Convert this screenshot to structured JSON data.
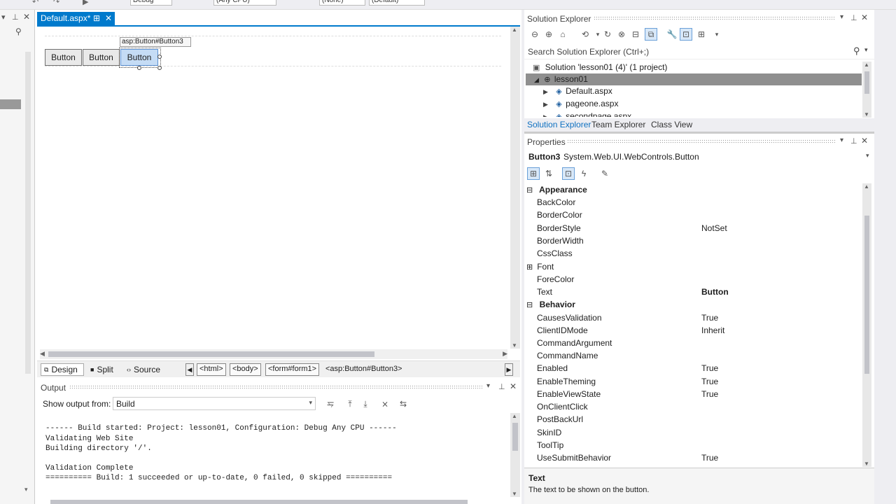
{
  "top_toolbar": {
    "config_value": "Debug",
    "cpu_value": "(Any CPU)",
    "none_value": "(None)",
    "default_value": "(Default)"
  },
  "doc_tab": {
    "label": "Default.aspx*",
    "pin": "⊞",
    "close": "✕"
  },
  "designer": {
    "tooltip": "asp:Button#Button3",
    "buttons": [
      "Button",
      "Button",
      "Button"
    ]
  },
  "view_bar": {
    "design": "Design",
    "split": "Split",
    "source": "Source",
    "breadcrumbs": [
      "<html>",
      "<body>",
      "<form#form1>"
    ],
    "current_crumb": "<asp:Button#Button3>"
  },
  "output": {
    "title": "Output",
    "show_from_label": "Show output from:",
    "source_value": "Build",
    "lines": [
      "------ Build started: Project: lesson01, Configuration: Debug Any CPU ------",
      "Validating Web Site",
      "Building directory '/'.",
      "",
      "Validation Complete",
      "========== Build: 1 succeeded or up-to-date, 0 failed, 0 skipped =========="
    ]
  },
  "solution_explorer": {
    "title": "Solution Explorer",
    "search_placeholder": "Search Solution Explorer (Ctrl+;)",
    "solution_node": "Solution 'lesson01 (4)' (1 project)",
    "project_node": "lesson01",
    "files": [
      "Default.aspx",
      "pageone.aspx",
      "secondpage.aspx"
    ],
    "tabs": [
      "Solution Explorer",
      "Team Explorer",
      "Class View"
    ]
  },
  "properties": {
    "title": "Properties",
    "object_name": "Button3",
    "object_type": "System.Web.UI.WebControls.Button",
    "categories": [
      {
        "name": "Appearance",
        "props": [
          {
            "name": "BackColor",
            "value": ""
          },
          {
            "name": "BorderColor",
            "value": ""
          },
          {
            "name": "BorderStyle",
            "value": "NotSet"
          },
          {
            "name": "BorderWidth",
            "value": ""
          },
          {
            "name": "CssClass",
            "value": ""
          },
          {
            "name": "Font",
            "value": ""
          },
          {
            "name": "ForeColor",
            "value": ""
          },
          {
            "name": "Text",
            "value": "Button"
          }
        ]
      },
      {
        "name": "Behavior",
        "props": [
          {
            "name": "CausesValidation",
            "value": "True"
          },
          {
            "name": "ClientIDMode",
            "value": "Inherit"
          },
          {
            "name": "CommandArgument",
            "value": ""
          },
          {
            "name": "CommandName",
            "value": ""
          },
          {
            "name": "Enabled",
            "value": "True"
          },
          {
            "name": "EnableTheming",
            "value": "True"
          },
          {
            "name": "EnableViewState",
            "value": "True"
          },
          {
            "name": "OnClientClick",
            "value": ""
          },
          {
            "name": "PostBackUrl",
            "value": ""
          },
          {
            "name": "SkinID",
            "value": ""
          },
          {
            "name": "ToolTip",
            "value": ""
          },
          {
            "name": "UseSubmitBehavior",
            "value": "True"
          }
        ]
      }
    ],
    "description_title": "Text",
    "description_text": "The text to be shown on the button."
  },
  "colors": {
    "accent": "#007acc",
    "selection": "#cce8ff"
  }
}
